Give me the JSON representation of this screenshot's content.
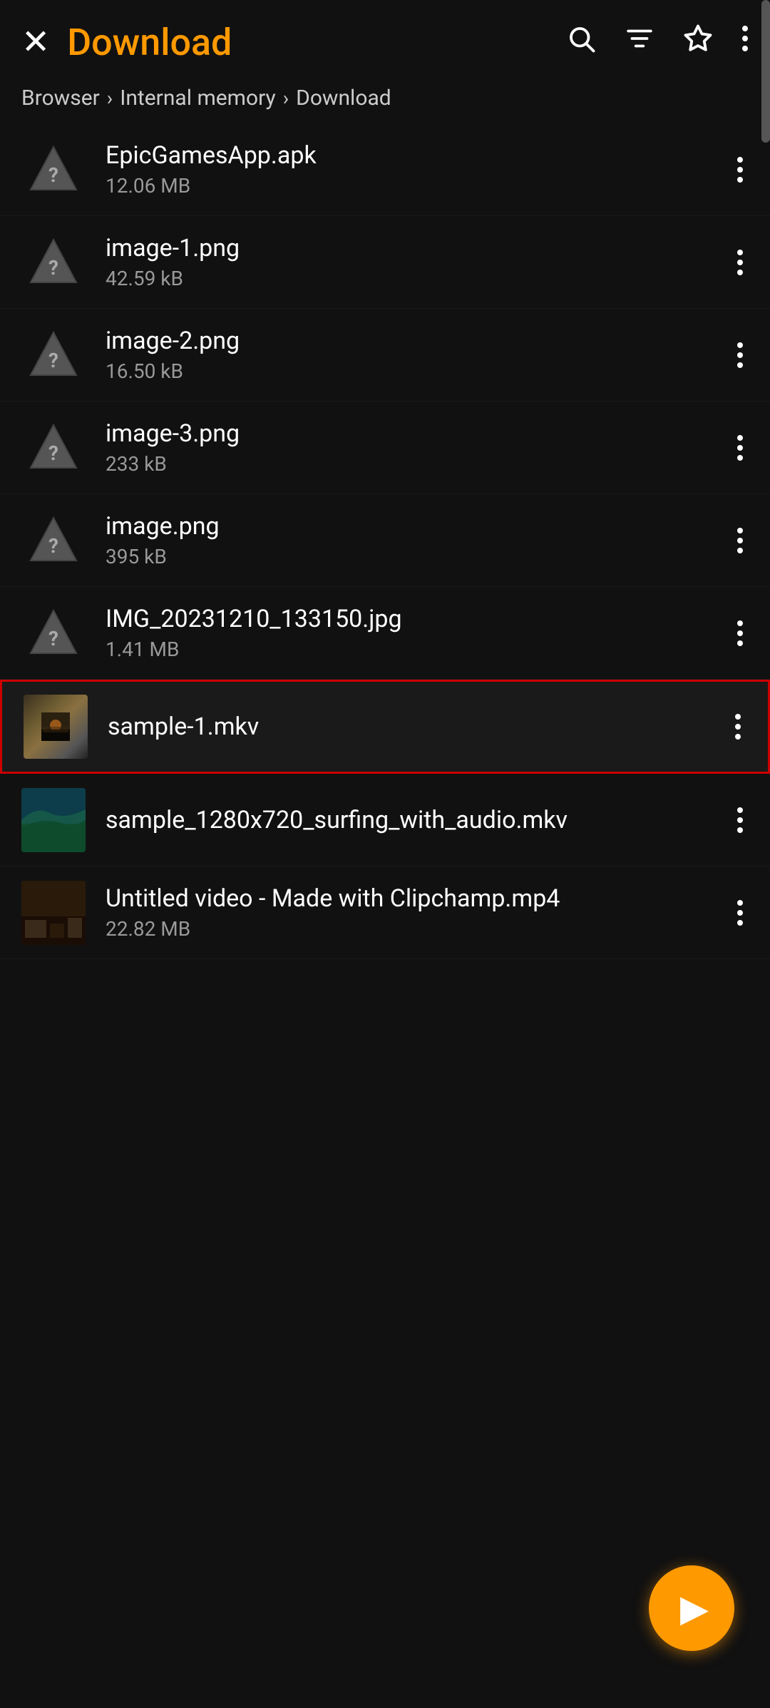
{
  "header": {
    "title": "Download",
    "close_label": "×"
  },
  "breadcrumb": {
    "items": [
      {
        "label": "Browser"
      },
      {
        "label": "Internal memory"
      },
      {
        "label": "Download"
      }
    ]
  },
  "files": [
    {
      "name": "EpicGamesApp.apk",
      "size": "12.06 MB",
      "type": "unknown",
      "thumb": null,
      "selected": false
    },
    {
      "name": "image-1.png",
      "size": "42.59 kB",
      "type": "unknown",
      "thumb": null,
      "selected": false
    },
    {
      "name": "image-2.png",
      "size": "16.50 kB",
      "type": "unknown",
      "thumb": null,
      "selected": false
    },
    {
      "name": "image-3.png",
      "size": "233 kB",
      "type": "unknown",
      "thumb": null,
      "selected": false
    },
    {
      "name": "image.png",
      "size": "395 kB",
      "type": "unknown",
      "thumb": null,
      "selected": false
    },
    {
      "name": "IMG_20231210_133150.jpg",
      "size": "1.41 MB",
      "type": "unknown",
      "thumb": null,
      "selected": false
    },
    {
      "name": "sample-1.mkv",
      "size": "",
      "type": "video1",
      "thumb": null,
      "selected": true
    },
    {
      "name": "sample_1280x720_surfing_with_audio.mkv",
      "size": "",
      "type": "video2",
      "thumb": null,
      "selected": false
    },
    {
      "name": "Untitled video - Made with Clipchamp.mp4",
      "size": "22.82 MB",
      "type": "video3",
      "thumb": null,
      "selected": false
    }
  ],
  "fab": {
    "label": "▶"
  }
}
